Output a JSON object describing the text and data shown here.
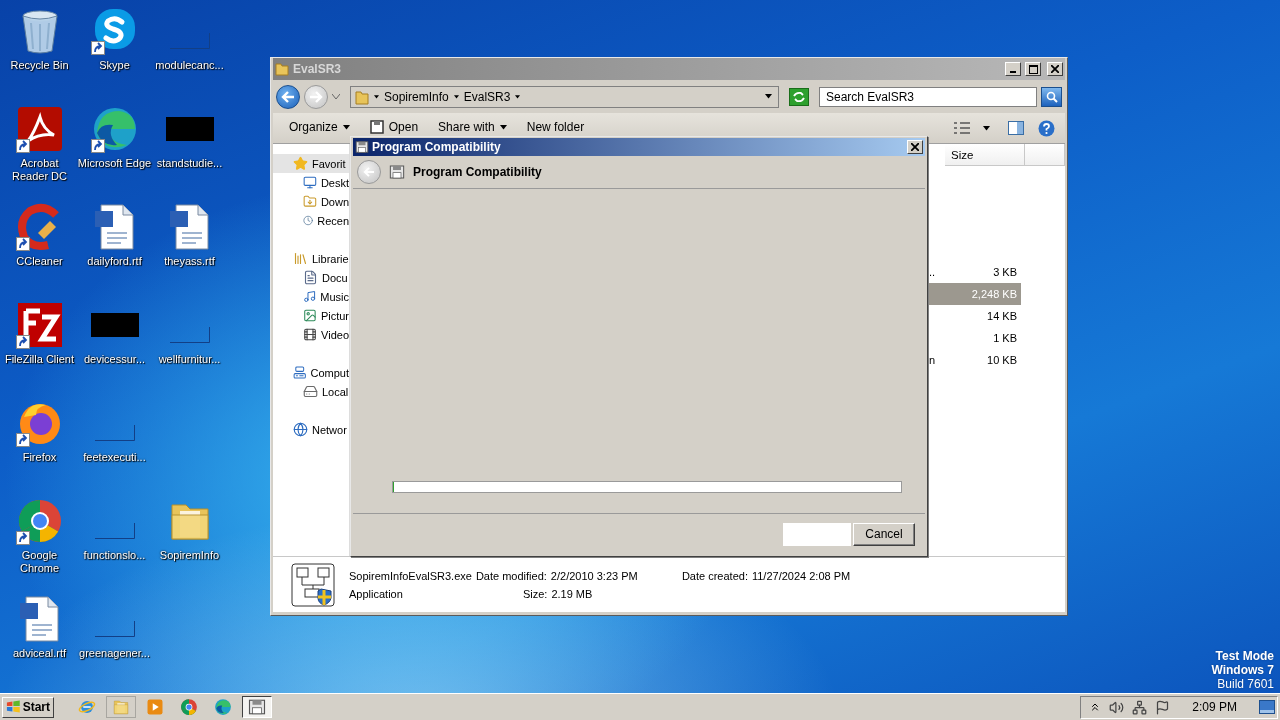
{
  "desktop_rows": [
    {
      "icons": [
        {
          "label": "Recycle Bin",
          "kind": "recycle",
          "shortcut": false
        },
        {
          "label": "Skype",
          "kind": "skype",
          "shortcut": true
        },
        {
          "label": "modulecanc...",
          "kind": "blank",
          "shortcut": false
        }
      ]
    },
    {
      "icons": [
        {
          "label": "Acrobat Reader DC",
          "kind": "acrobat",
          "shortcut": true
        },
        {
          "label": "Microsoft Edge",
          "kind": "edge",
          "shortcut": true
        },
        {
          "label": "standstudie...",
          "kind": "black",
          "shortcut": false
        }
      ]
    },
    {
      "icons": [
        {
          "label": "CCleaner",
          "kind": "ccleaner",
          "shortcut": true
        },
        {
          "label": "dailyford.rtf",
          "kind": "word",
          "shortcut": false
        },
        {
          "label": "theyass.rtf",
          "kind": "word",
          "shortcut": false
        }
      ]
    },
    {
      "icons": [
        {
          "label": "FileZilla Client",
          "kind": "filezilla",
          "shortcut": true
        },
        {
          "label": "devicessur...",
          "kind": "black",
          "shortcut": false
        },
        {
          "label": "wellfurnitur...",
          "kind": "blank",
          "shortcut": false
        }
      ]
    },
    {
      "icons": [
        {
          "label": "Firefox",
          "kind": "firefox",
          "shortcut": true
        },
        {
          "label": "feetexecuti...",
          "kind": "blank",
          "shortcut": false
        }
      ]
    },
    {
      "icons": [
        {
          "label": "Google Chrome",
          "kind": "chrome",
          "shortcut": true
        },
        {
          "label": "functionslo...",
          "kind": "blank",
          "shortcut": false
        },
        {
          "label": "SopiremInfo",
          "kind": "folder",
          "shortcut": false
        }
      ]
    },
    {
      "icons": [
        {
          "label": "adviceal.rtf",
          "kind": "word",
          "shortcut": false
        },
        {
          "label": "greenagener...",
          "kind": "blank",
          "shortcut": false
        }
      ]
    }
  ],
  "explorer": {
    "title": "EvalSR3",
    "path": [
      "SopiremInfo",
      "EvalSR3"
    ],
    "search": {
      "placeholder": "Search EvalSR3"
    },
    "toolbar": [
      {
        "label": "Organize",
        "kind": "menu"
      },
      {
        "label": "Open",
        "kind": "icon"
      },
      {
        "label": "Share with",
        "kind": "menu"
      },
      {
        "label": "New folder",
        "kind": "plain"
      }
    ],
    "nav": [
      {
        "label": "Favorit",
        "kind": "star",
        "selected": true,
        "children": [
          {
            "label": "Deskt",
            "kind": "desktop",
            "selected": false
          },
          {
            "label": "Down",
            "kind": "download",
            "selected": false
          },
          {
            "label": "Recen",
            "kind": "recent",
            "selected": false
          }
        ]
      },
      {
        "label": "Librarie",
        "kind": "library",
        "selected": false,
        "children": [
          {
            "label": "Docu",
            "kind": "document",
            "selected": false
          },
          {
            "label": "Music",
            "kind": "music",
            "selected": false
          },
          {
            "label": "Pictur",
            "kind": "picture",
            "selected": false
          },
          {
            "label": "Video",
            "kind": "video",
            "selected": false
          }
        ]
      },
      {
        "label": "Comput",
        "kind": "computer",
        "selected": false,
        "children": [
          {
            "label": "Local",
            "kind": "drive",
            "selected": false
          }
        ]
      },
      {
        "label": "Networ",
        "kind": "network",
        "selected": false
      }
    ],
    "columns": [
      "Size"
    ],
    "rows": [
      {
        "name": "..",
        "size": "3 KB",
        "selected": false
      },
      {
        "size": "2,248 KB",
        "selected": true
      },
      {
        "size": "14 KB",
        "selected": false
      },
      {
        "size": "1 KB",
        "selected": false
      },
      {
        "name": "n",
        "size": "10 KB",
        "selected": false
      }
    ],
    "details": {
      "file_name": "SopiremInfoEvalSR3.exe",
      "type": "Application",
      "modified": {
        "label": "Date modified:",
        "value": "2/2/2010 3:23 PM"
      },
      "size": {
        "label": "Size:",
        "value": "2.19 MB"
      },
      "created": {
        "label": "Date created:",
        "value": "11/27/2024 2:08 PM"
      }
    }
  },
  "dialog": {
    "title": "Program Compatibility",
    "heading": "Program Compatibility",
    "progress": {
      "level": 0
    },
    "buttons": [
      "Cancel"
    ]
  },
  "taskbar": {
    "start": "Start",
    "apps": [
      {
        "kind": "ie",
        "running": false,
        "active": false
      },
      {
        "kind": "folder",
        "running": true,
        "active": false
      },
      {
        "kind": "media",
        "running": false,
        "active": false
      },
      {
        "kind": "chrome",
        "running": false,
        "active": false
      },
      {
        "kind": "edge",
        "running": false,
        "active": false
      },
      {
        "kind": "program",
        "running": true,
        "active": true
      }
    ],
    "clock": "2:09 PM"
  },
  "os_notice": [
    {
      "text": "Test Mode",
      "kind": "heading"
    },
    {
      "text": "Windows 7",
      "kind": "heading"
    },
    {
      "text": "Build 7601",
      "kind": "plain"
    }
  ]
}
